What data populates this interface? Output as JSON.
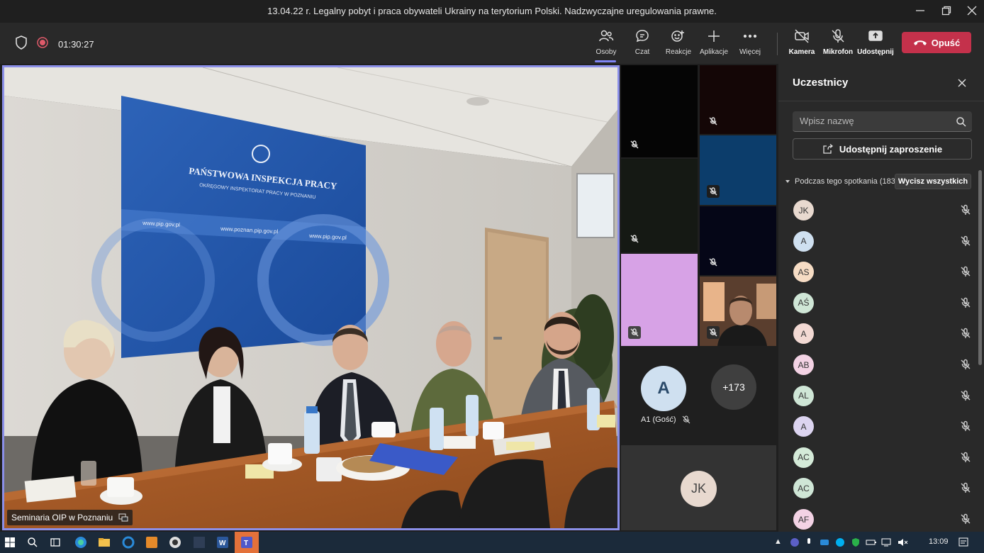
{
  "window": {
    "title": "13.04.22 r. Legalny pobyt i praca obywateli Ukrainy na terytorium Polski. Nadzwyczajne uregulowania prawne."
  },
  "toolbar": {
    "timer": "01:30:27",
    "buttons": {
      "people": "Osoby",
      "chat": "Czat",
      "reactions": "Reakcje",
      "apps": "Aplikacje",
      "more": "Więcej",
      "camera": "Kamera",
      "mic": "Mikrofon",
      "share": "Udostępnij"
    },
    "leave": "Opuść"
  },
  "stage": {
    "caption": "Seminaria OIP w Poznaniu",
    "sign": {
      "org": "PAŃSTWOWA INSPEKCJA PRACY",
      "sub": "OKRĘGOWY INSPEKTORAT PRACY W POZNANIU",
      "url1": "www.pip.gov.pl",
      "url2": "www.poznan.pip.gov.pl",
      "url3": "www.pip.gov.pl"
    }
  },
  "gallery": {
    "tile_colors": [
      "#050505",
      "#140606",
      "#151914",
      "#0c3d6b",
      "#050617",
      "#d7a2e6"
    ],
    "featured": {
      "initial": "A",
      "name": "A1 (Gość)"
    },
    "overflow": "+173",
    "bottom_initials": "JK"
  },
  "panel": {
    "title": "Uczestnicy",
    "search_placeholder": "Wpisz nazwę",
    "share_invite": "Udostępnij zaproszenie",
    "section": "Podczas tego spotkania (183)",
    "mute_all": "Wycisz wszystkich",
    "participants": [
      {
        "initials": "JK",
        "color": "#e8d9cf"
      },
      {
        "initials": "A",
        "color": "#cfe0f0"
      },
      {
        "initials": "AS",
        "color": "#f6dcc4"
      },
      {
        "initials": "AŚ",
        "color": "#cfe6d6"
      },
      {
        "initials": "A",
        "color": "#f2d9d3"
      },
      {
        "initials": "AB",
        "color": "#f3d2e4"
      },
      {
        "initials": "AL",
        "color": "#cfe6d6"
      },
      {
        "initials": "A",
        "color": "#dcd4f0"
      },
      {
        "initials": "AC",
        "color": "#d4ead8"
      },
      {
        "initials": "AC",
        "color": "#cfe6d6"
      },
      {
        "initials": "AF",
        "color": "#f3d2e4"
      }
    ]
  },
  "taskbar": {
    "time": "13:09"
  }
}
